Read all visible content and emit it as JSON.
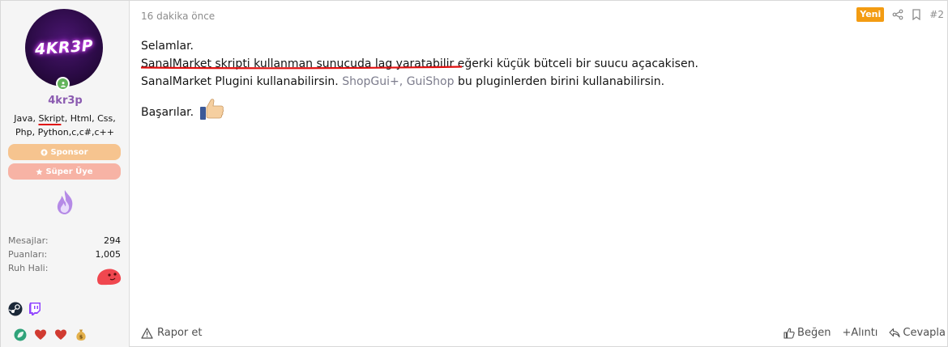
{
  "user": {
    "avatar_text": "4KR3P",
    "username": "4kr3p",
    "title_pre": "Java, ",
    "title_underlined": "Skrip",
    "title_post": "t, Html, Css, Php, Python,c,c#,c++",
    "banners": [
      "Sponsor",
      "Süper Üye"
    ],
    "stats": [
      {
        "label": "Mesajlar:",
        "value": "294"
      },
      {
        "label": "Puanları:",
        "value": "1,005"
      },
      {
        "label": "Ruh Hali:",
        "value": ""
      }
    ],
    "contact_icons": [
      "steam-icon",
      "twitch-icon"
    ],
    "trophy_icons": [
      "leaf-badge-icon",
      "heart-icon",
      "heart-icon",
      "money-bag-icon"
    ]
  },
  "message": {
    "date": "16 dakika önce",
    "new_badge": "Yeni",
    "post_number": "#2",
    "greeting": "Selamlar.",
    "line2_underlined": "SanalMarket skripti kullanman sunucuda lag yaratabilir ",
    "line2_rest": "eğerki küçük bütceli bir suucu açacakisen.",
    "line3_pre": "SanalMarket Plugini kullanabilirsin. ",
    "link1": "ShopGui+",
    "line3_sep": ", ",
    "link2": "GuiShop",
    "line3_post": " bu pluginlerden birini kullanabilirsin.",
    "closing": "Başarılar."
  },
  "footer": {
    "report": "Rapor et",
    "like": "Beğen",
    "quote": "+Alıntı",
    "reply": "Cevapla"
  },
  "colors": {
    "username": "#8a5ab0",
    "sponsor_banner": "#f6c48f",
    "super_banner": "#f7b3a5",
    "new_badge": "#f39c12",
    "online": "#63b35a",
    "annotation_red": "#e01010"
  }
}
